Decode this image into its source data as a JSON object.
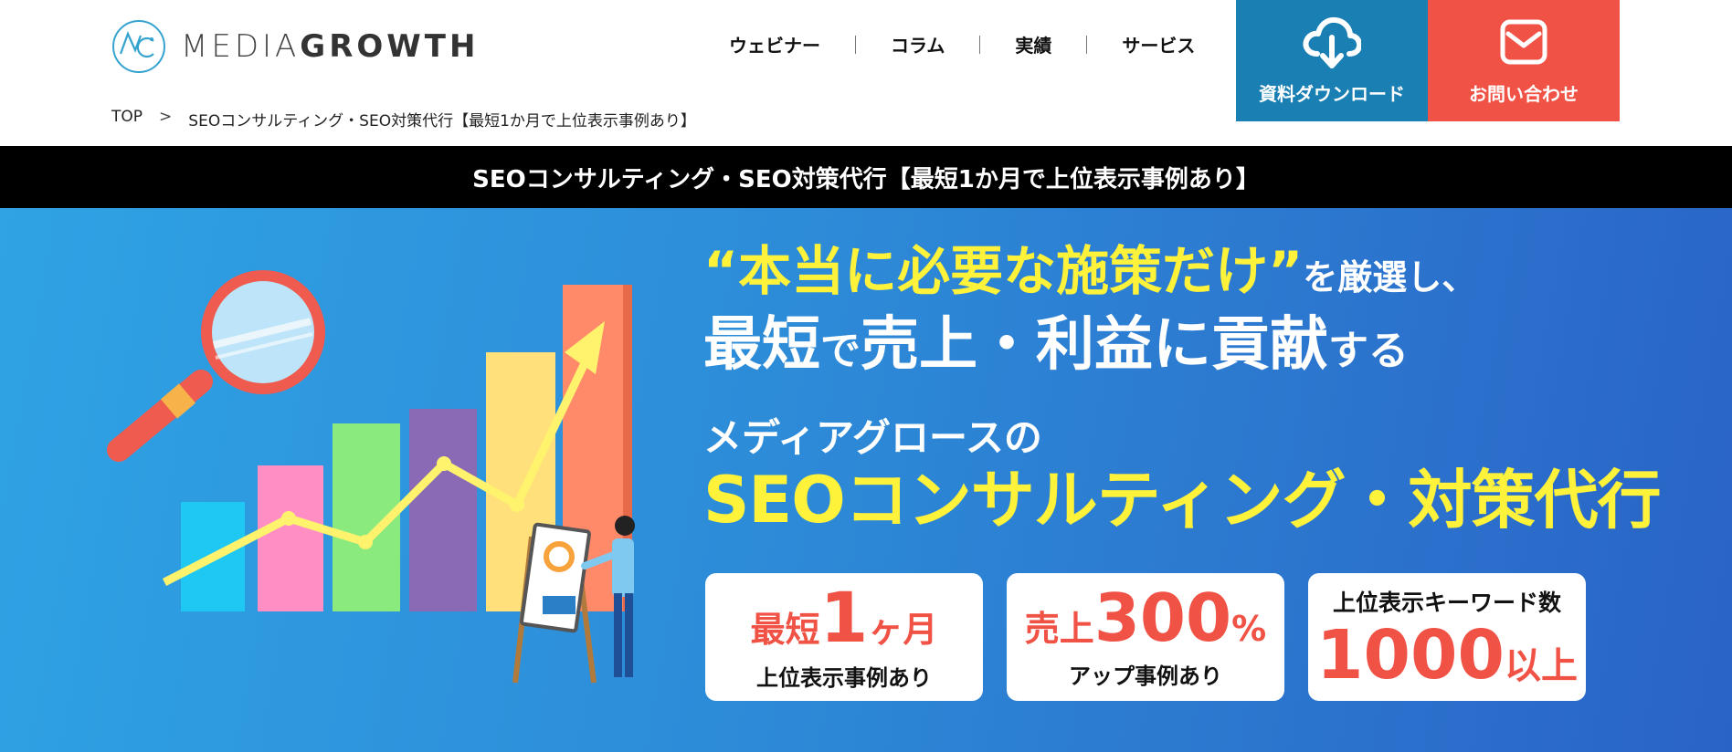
{
  "header": {
    "logo": {
      "light": "MEDIA",
      "bold": "GROWTH"
    },
    "nav": [
      "ウェビナー",
      "コラム",
      "実績",
      "サービス"
    ],
    "cta_download": "資料ダウンロード",
    "cta_contact": "お問い合わせ",
    "breadcrumb": {
      "home": "TOP",
      "separator": ">",
      "current": "SEOコンサルティング・SEO対策代行【最短1か月で上位表示事例あり】"
    }
  },
  "title_bar": "SEOコンサルティング・SEO対策代行【最短1か月で上位表示事例あり】",
  "hero": {
    "line1_highlight": "“本当に必要な施策だけ”",
    "line1_rest": "を厳選し、",
    "line2_a": "最短",
    "line2_b": "で",
    "line2_c": "売上・利益に貢献",
    "line2_d": "する",
    "line3": "メディアグロースの",
    "line4": "SEOコンサルティング・対策代行",
    "badges": [
      {
        "pre": "最短",
        "num": "1",
        "unit": "ヶ月",
        "sub": "上位表示事例あり"
      },
      {
        "pre": "売上",
        "num": "300",
        "unit": "%",
        "sub": "アップ事例あり"
      },
      {
        "top": "上位表示キーワード数",
        "num": "1000",
        "unit": "以上"
      }
    ]
  },
  "colors": {
    "download": "#1a7fb3",
    "contact": "#f05245",
    "highlight": "#fff23a",
    "accent_red": "#f05245"
  }
}
